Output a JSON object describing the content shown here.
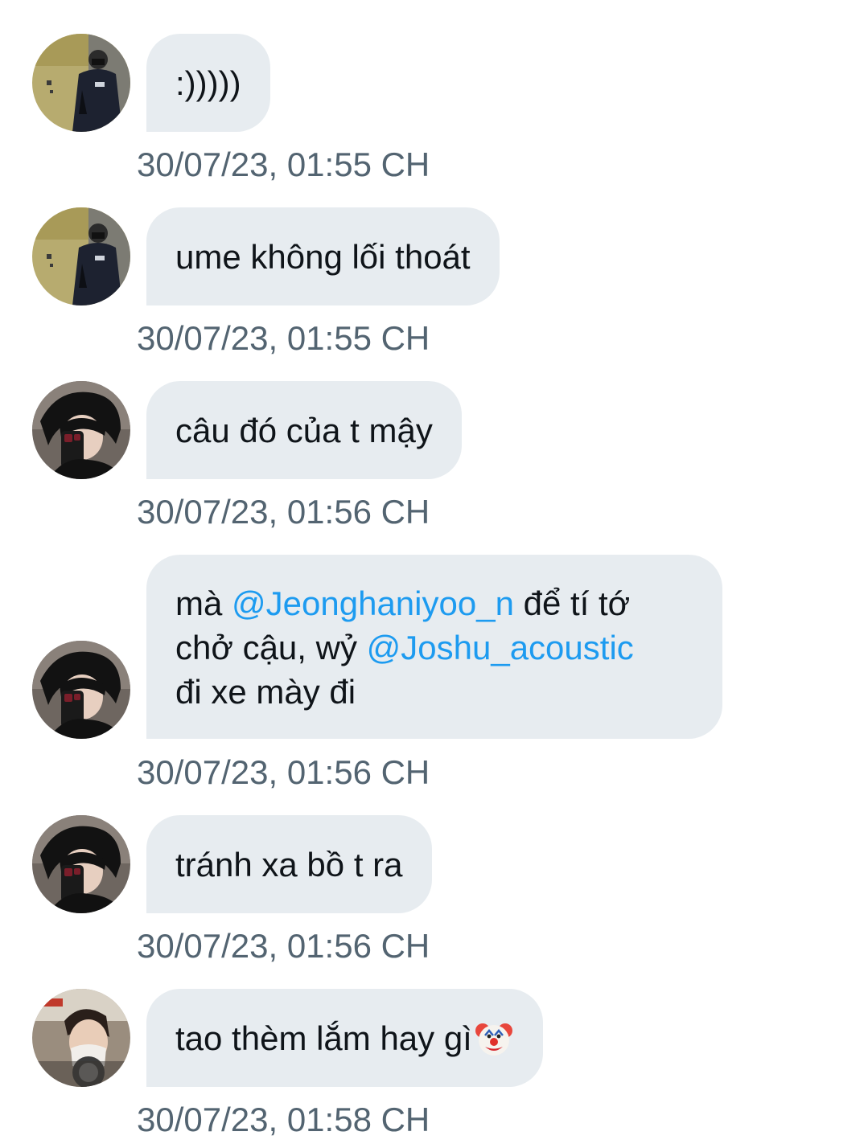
{
  "conversation": {
    "messages": [
      {
        "avatar": "user-a-avatar",
        "text": ":)))))",
        "timestamp": "30/07/23, 01:55 CH"
      },
      {
        "avatar": "user-a-avatar",
        "text": "ume không lối thoát",
        "timestamp": "30/07/23, 01:55 CH"
      },
      {
        "avatar": "user-b-avatar",
        "text": "câu đó của t mậy",
        "timestamp": "30/07/23, 01:56 CH"
      },
      {
        "avatar": "user-b-avatar",
        "text_parts": {
          "p1": "mà ",
          "mention1": "@Jeonghaniyoo_n",
          "p2": " để tí tớ\nchở cậu, wỷ ",
          "mention2": "@Joshu_acoustic",
          "p3": "\nđi xe mày đi"
        },
        "timestamp": "30/07/23, 01:56 CH"
      },
      {
        "avatar": "user-b-avatar",
        "text": "tránh xa bồ t ra",
        "timestamp": "30/07/23, 01:56 CH"
      },
      {
        "avatar": "user-c-avatar",
        "text": "tao thèm lắm hay gì",
        "emoji": "clown-face-icon",
        "timestamp": "30/07/23, 01:58 CH"
      }
    ]
  },
  "colors": {
    "bubble_bg": "#e7ecf0",
    "text": "#0f1419",
    "timestamp": "#536471",
    "mention": "#1d9bf0"
  }
}
